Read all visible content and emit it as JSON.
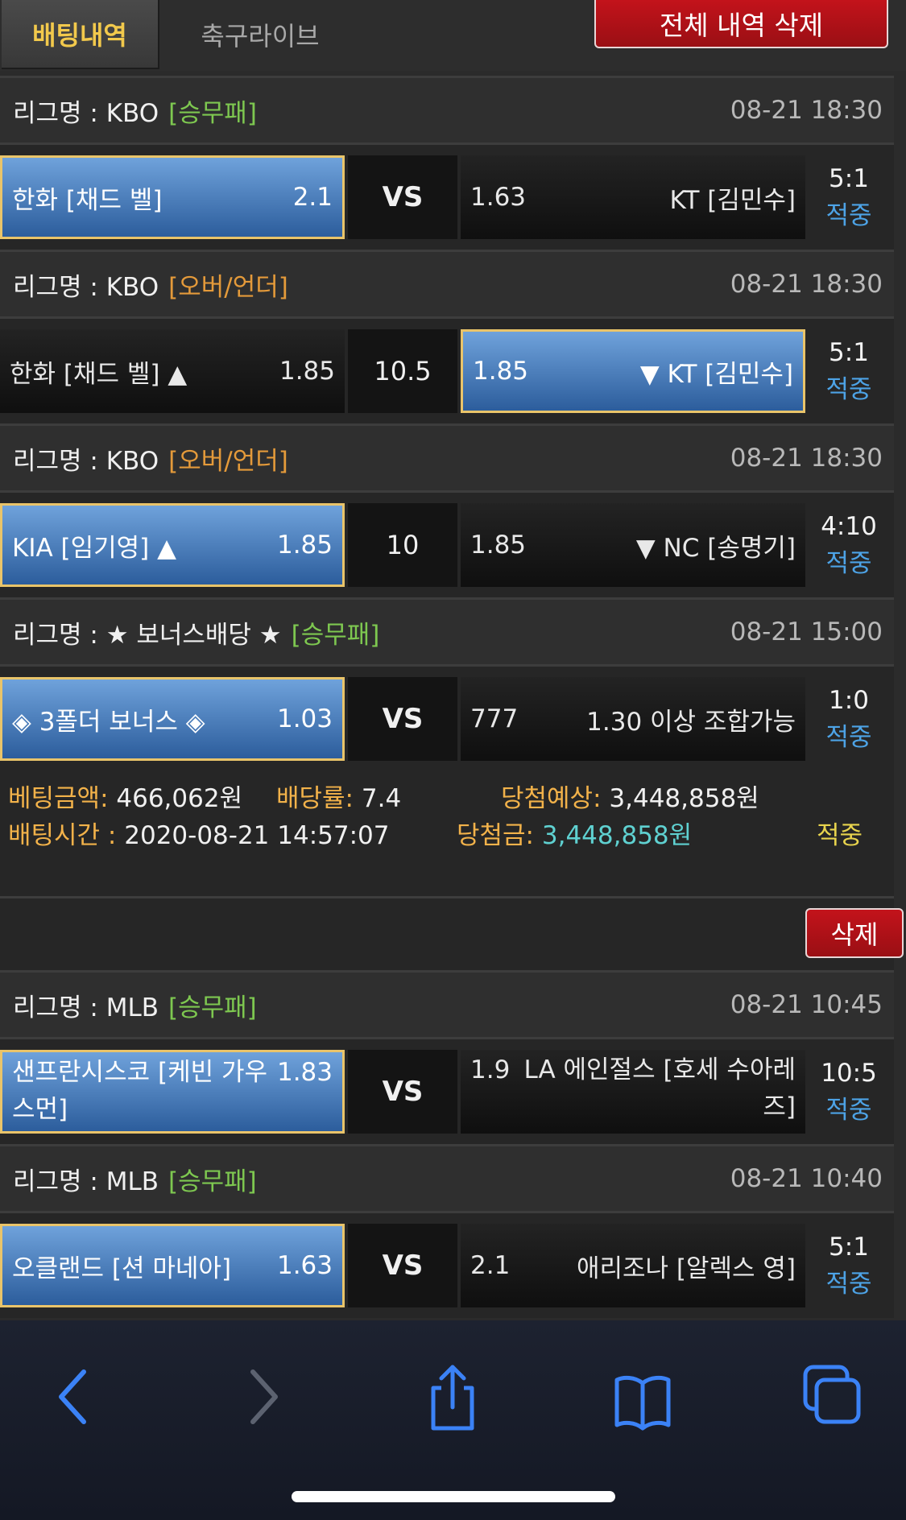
{
  "tabs": {
    "betting_history": "배팅내역",
    "soccer_live": "축구라이브"
  },
  "delete_all_label": "전체 내역 삭제",
  "slip1": {
    "games": [
      {
        "league": "리그명 : KBO",
        "type": "[승무패]",
        "time": "08-21 18:30",
        "home": "한화 [채드 벨]",
        "home_odds": "2.1",
        "mid": "VS",
        "away_odds": "1.63",
        "away": "KT [김민수]",
        "score": "5:1",
        "status": "적중"
      },
      {
        "league": "리그명 : KBO",
        "type": "[오버/언더]",
        "time": "08-21 18:30",
        "home": "한화 [채드 벨] ▲",
        "home_odds": "1.85",
        "mid": "10.5",
        "away_odds": "1.85",
        "away": "▼ KT [김민수]",
        "score": "5:1",
        "status": "적중"
      },
      {
        "league": "리그명 : KBO",
        "type": "[오버/언더]",
        "time": "08-21 18:30",
        "home": "KIA [임기영] ▲",
        "home_odds": "1.85",
        "mid": "10",
        "away_odds": "1.85",
        "away": "▼ NC [송명기]",
        "score": "4:10",
        "status": "적중"
      },
      {
        "league": "리그명 : ★ 보너스배당 ★",
        "type": "[승무패]",
        "time": "08-21 15:00",
        "home": "◈ 3폴더 보너스 ◈",
        "home_odds": "1.03",
        "mid": "VS",
        "away_odds": "777",
        "away": "1.30 이상 조합가능",
        "score": "1:0",
        "status": "적중"
      }
    ],
    "summary": {
      "bet_amount_label": "베팅금액:",
      "bet_amount": "466,062원",
      "rate_label": "배당률:",
      "rate": "7.4",
      "expected_label": "당첨예상:",
      "expected": "3,448,858원",
      "bet_time_label": "배팅시간 :",
      "bet_time": "2020-08-21 14:57:07",
      "win_label": "당첨금:",
      "win": "3,448,858원",
      "status": "적중"
    }
  },
  "delete_label": "삭제",
  "slip2": {
    "games": [
      {
        "league": "리그명 : MLB",
        "type": "[승무패]",
        "time": "08-21 10:45",
        "home_line1": "샌프란시스코 [케빈 가우",
        "home_line2": "스먼]",
        "home_odds": "1.83",
        "mid": "VS",
        "away_odds": "1.9",
        "away_line1": "LA 에인절스 [호세 수아레",
        "away_line2": "즈]",
        "score": "10:5",
        "status": "적중"
      },
      {
        "league": "리그명 : MLB",
        "type": "[승무패]",
        "time": "08-21 10:40",
        "home": "오클랜드 [션 마네아]",
        "home_odds": "1.63",
        "mid": "VS",
        "away_odds": "2.1",
        "away": "애리조나 [알렉스 영]",
        "score": "5:1",
        "status": "적중"
      }
    ]
  },
  "toolbar": [
    "back-icon",
    "forward-icon",
    "share-icon",
    "bookmarks-icon",
    "tabs-icon"
  ],
  "colors": {
    "accent_blue": "#3f78c0",
    "win_cyan": "#5fd1d1",
    "delete_red": "#b01218",
    "label_orange": "#f2b24a"
  }
}
